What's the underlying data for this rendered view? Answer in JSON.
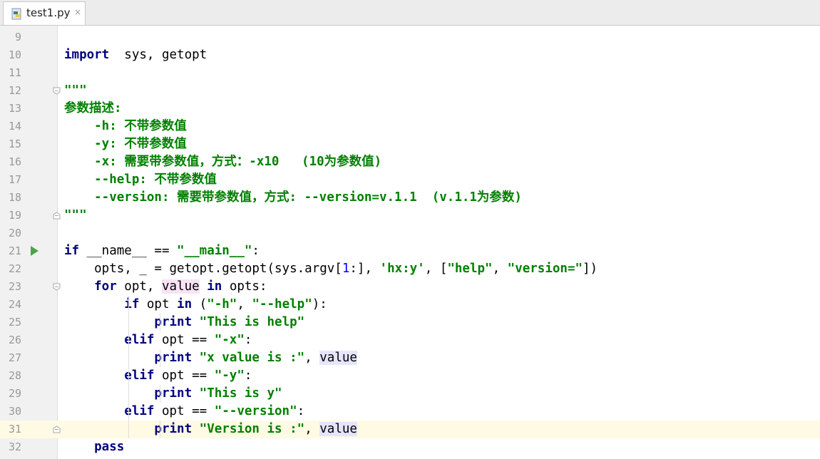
{
  "tab": {
    "filename": "test1.py",
    "file_icon": "python-file-icon",
    "close_glyph": "×",
    "close_icon": "close-icon"
  },
  "colors": {
    "keyword": "#000080",
    "string": "#008000",
    "number": "#0000ff",
    "current_line": "#fffae3",
    "run_arrow": "#4aa54a"
  },
  "editor": {
    "current_line": 31,
    "run_marker_line": 21,
    "lines": [
      {
        "n": "9",
        "tokens": []
      },
      {
        "n": "10",
        "tokens": [
          [
            "kw",
            "import"
          ],
          [
            "",
            "  sys, getopt"
          ]
        ]
      },
      {
        "n": "11",
        "tokens": []
      },
      {
        "n": "12",
        "tokens": [
          [
            "doc",
            "\"\"\""
          ]
        ]
      },
      {
        "n": "13",
        "tokens": [
          [
            "doc",
            "参数描述:"
          ]
        ]
      },
      {
        "n": "14",
        "tokens": [
          [
            "doc",
            "    -h: 不带参数值"
          ]
        ]
      },
      {
        "n": "15",
        "tokens": [
          [
            "doc",
            "    -y: 不带参数值"
          ]
        ]
      },
      {
        "n": "16",
        "tokens": [
          [
            "doc",
            "    -x: 需要带参数值，方式：-x10   (10为参数值)"
          ]
        ]
      },
      {
        "n": "17",
        "tokens": [
          [
            "doc",
            "    --help: 不带参数值"
          ]
        ]
      },
      {
        "n": "18",
        "tokens": [
          [
            "doc",
            "    --version: 需要带参数值，方式: --version=v.1.1  (v.1.1为参数)"
          ]
        ]
      },
      {
        "n": "19",
        "tokens": [
          [
            "doc",
            "\"\"\""
          ]
        ]
      },
      {
        "n": "20",
        "tokens": []
      },
      {
        "n": "21",
        "tokens": [
          [
            "kw",
            "if"
          ],
          [
            "",
            " __name__ == "
          ],
          [
            "str",
            "\"__main__\""
          ],
          [
            "",
            ":"
          ]
        ]
      },
      {
        "n": "22",
        "tokens": [
          [
            "",
            "    opts, _ = getopt.getopt(sys.argv["
          ],
          [
            "num",
            "1"
          ],
          [
            "",
            ":], "
          ],
          [
            "str",
            "'hx:y'"
          ],
          [
            "",
            ", ["
          ],
          [
            "str",
            "\"help\""
          ],
          [
            "",
            ", "
          ],
          [
            "str",
            "\"version=\""
          ],
          [
            "",
            "])"
          ]
        ]
      },
      {
        "n": "23",
        "tokens": [
          [
            "kw",
            "    for"
          ],
          [
            "",
            " opt, "
          ],
          [
            "hl-pink",
            "value"
          ],
          [
            "kw",
            " in"
          ],
          [
            "",
            " opts:"
          ]
        ]
      },
      {
        "n": "24",
        "tokens": [
          [
            "kw",
            "        if"
          ],
          [
            "",
            " opt "
          ],
          [
            "kw",
            "in"
          ],
          [
            "",
            " ("
          ],
          [
            "str",
            "\"-h\""
          ],
          [
            "",
            ", "
          ],
          [
            "str",
            "\"--help\""
          ],
          [
            "",
            "):"
          ]
        ]
      },
      {
        "n": "25",
        "tokens": [
          [
            "kw",
            "            print"
          ],
          [
            "",
            " "
          ],
          [
            "str",
            "\"This is help\""
          ]
        ]
      },
      {
        "n": "26",
        "tokens": [
          [
            "kw",
            "        elif"
          ],
          [
            "",
            " opt == "
          ],
          [
            "str",
            "\"-x\""
          ],
          [
            "",
            ":"
          ]
        ]
      },
      {
        "n": "27",
        "tokens": [
          [
            "kw",
            "            print"
          ],
          [
            "",
            " "
          ],
          [
            "str",
            "\"x value is :\""
          ],
          [
            "",
            ", "
          ],
          [
            "hl-grey",
            "value"
          ]
        ]
      },
      {
        "n": "28",
        "tokens": [
          [
            "kw",
            "        elif"
          ],
          [
            "",
            " opt == "
          ],
          [
            "str",
            "\"-y\""
          ],
          [
            "",
            ":"
          ]
        ]
      },
      {
        "n": "29",
        "tokens": [
          [
            "kw",
            "            print"
          ],
          [
            "",
            " "
          ],
          [
            "str",
            "\"This is y\""
          ]
        ]
      },
      {
        "n": "30",
        "tokens": [
          [
            "kw",
            "        elif"
          ],
          [
            "",
            " opt == "
          ],
          [
            "str",
            "\"--version\""
          ],
          [
            "",
            ":"
          ]
        ]
      },
      {
        "n": "31",
        "tokens": [
          [
            "kw",
            "            print"
          ],
          [
            "",
            " "
          ],
          [
            "str",
            "\"Version is :\""
          ],
          [
            "",
            ", "
          ],
          [
            "hl-grey",
            "value"
          ]
        ]
      },
      {
        "n": "32",
        "tokens": [
          [
            "kw",
            "    pass"
          ]
        ]
      }
    ]
  }
}
